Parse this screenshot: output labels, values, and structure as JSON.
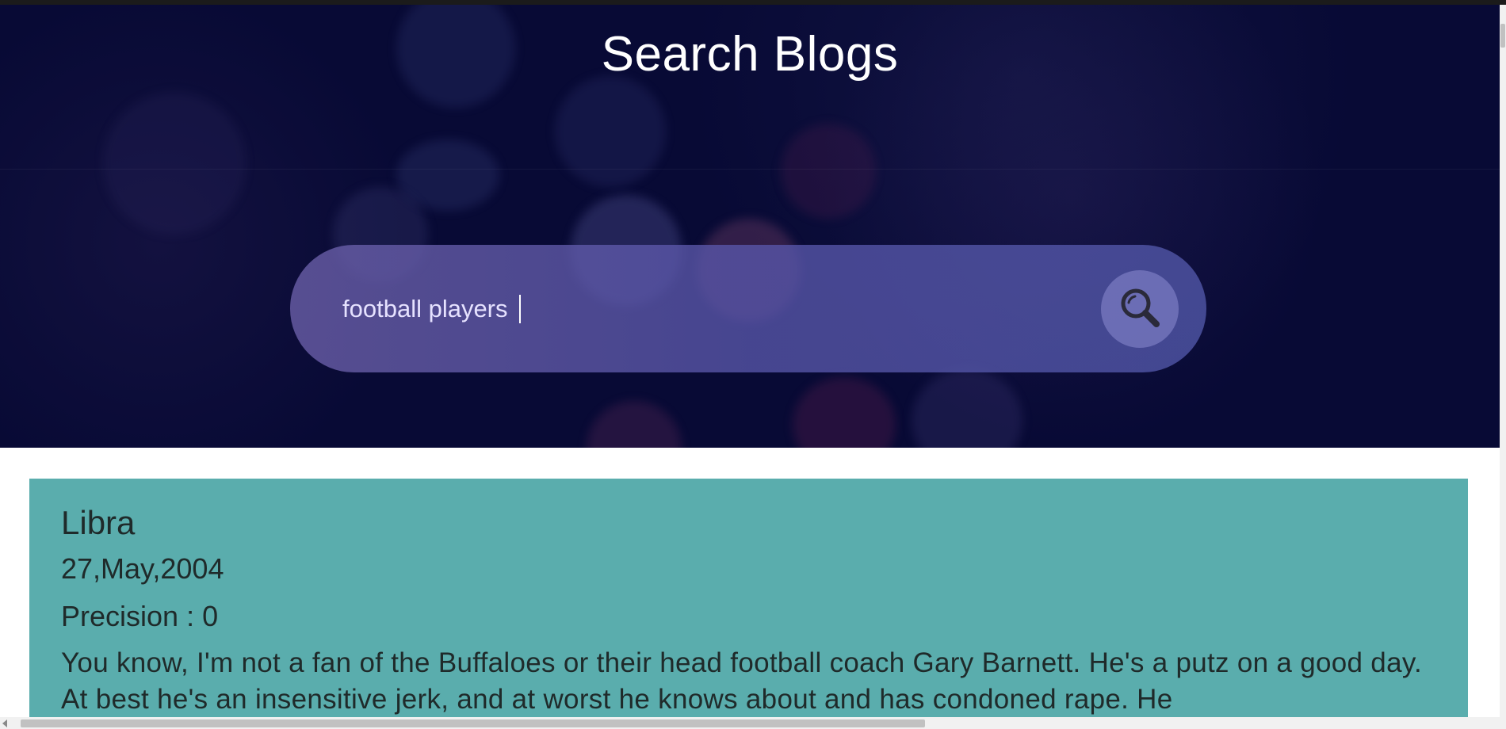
{
  "header": {
    "title": "Search Blogs"
  },
  "search": {
    "value": "football players",
    "button_icon": "search-icon"
  },
  "results": [
    {
      "title": "Libra",
      "date": "27,May,2004",
      "precision": "Precision : 0",
      "snippet": "You know, I'm not a fan of the Buffaloes or their head football coach Gary Barnett. He's a putz on a good day. At best he's an insensitive jerk, and at worst he knows about and has condoned rape. He"
    }
  ],
  "colors": {
    "hero_background": "#080a35",
    "card_background": "#5aadad",
    "search_bar": "#6c60aa"
  }
}
